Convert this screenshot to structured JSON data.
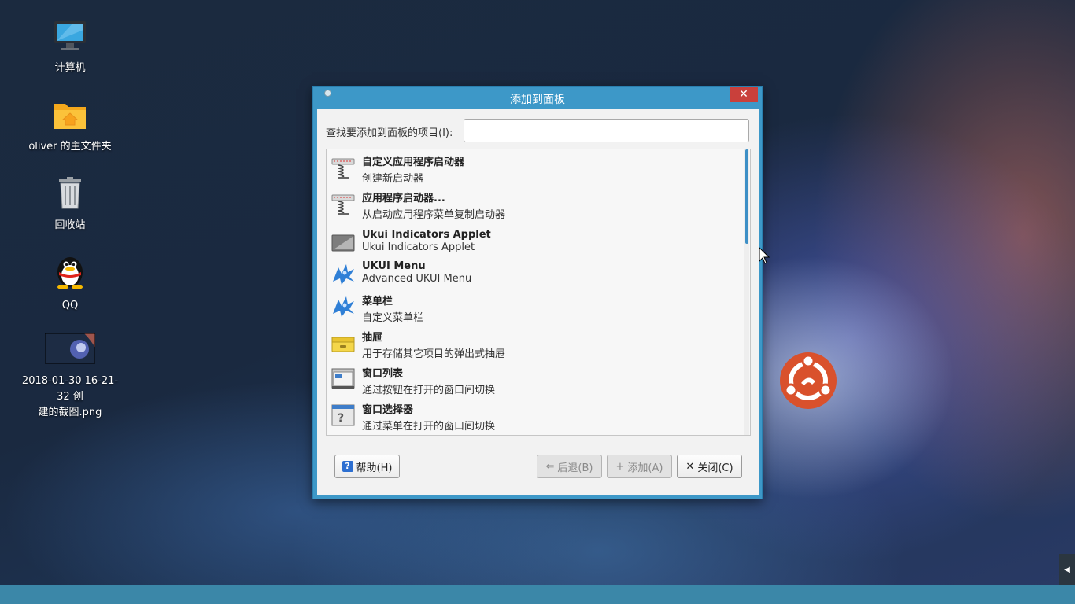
{
  "desktop": {
    "icons": [
      {
        "label": "计算机",
        "icon": "computer-icon"
      },
      {
        "label": "oliver 的主文件夹",
        "icon": "home-folder-icon"
      },
      {
        "label": "回收站",
        "icon": "trash-icon"
      },
      {
        "label": "QQ",
        "icon": "qq-penguin-icon"
      },
      {
        "label_line1": "2018-01-30 16-21-32 创",
        "label_line2": "建的截图.png",
        "icon": "image-thumbnail-icon"
      }
    ]
  },
  "dialog": {
    "title": "添加到面板",
    "search_label": "查找要添加到面板的项目(I):",
    "search_value": "",
    "items": [
      {
        "name": "自定义应用程序启动器",
        "desc": "创建新启动器",
        "icon": "launcher-spring-icon"
      },
      {
        "name": "应用程序启动器...",
        "desc": "从启动应用程序菜单复制启动器",
        "icon": "launcher-spring-icon"
      },
      {
        "name": "Ukui Indicators Applet",
        "desc": "Ukui Indicators Applet",
        "icon": "indicator-applet-icon"
      },
      {
        "name": "UKUI Menu",
        "desc": "Advanced UKUI Menu",
        "icon": "ukui-menu-icon"
      },
      {
        "name": "菜单栏",
        "desc": "自定义菜单栏",
        "icon": "menu-bar-icon"
      },
      {
        "name": "抽屉",
        "desc": "用于存储其它项目的弹出式抽屉",
        "icon": "drawer-icon"
      },
      {
        "name": "窗口列表",
        "desc": "通过按钮在打开的窗口间切换",
        "icon": "window-list-icon"
      },
      {
        "name": "窗口选择器",
        "desc": "通过菜单在打开的窗口间切换",
        "icon": "window-selector-icon"
      }
    ],
    "buttons": {
      "help": "帮助(H)",
      "back": "后退(B)",
      "add": "添加(A)",
      "close": "关闭(C)"
    }
  },
  "colors": {
    "dialog_frame": "#3d98c8",
    "close_button": "#c9403b",
    "taskbar": "#3b87a8",
    "scroll_thumb": "#3d8fc6"
  }
}
